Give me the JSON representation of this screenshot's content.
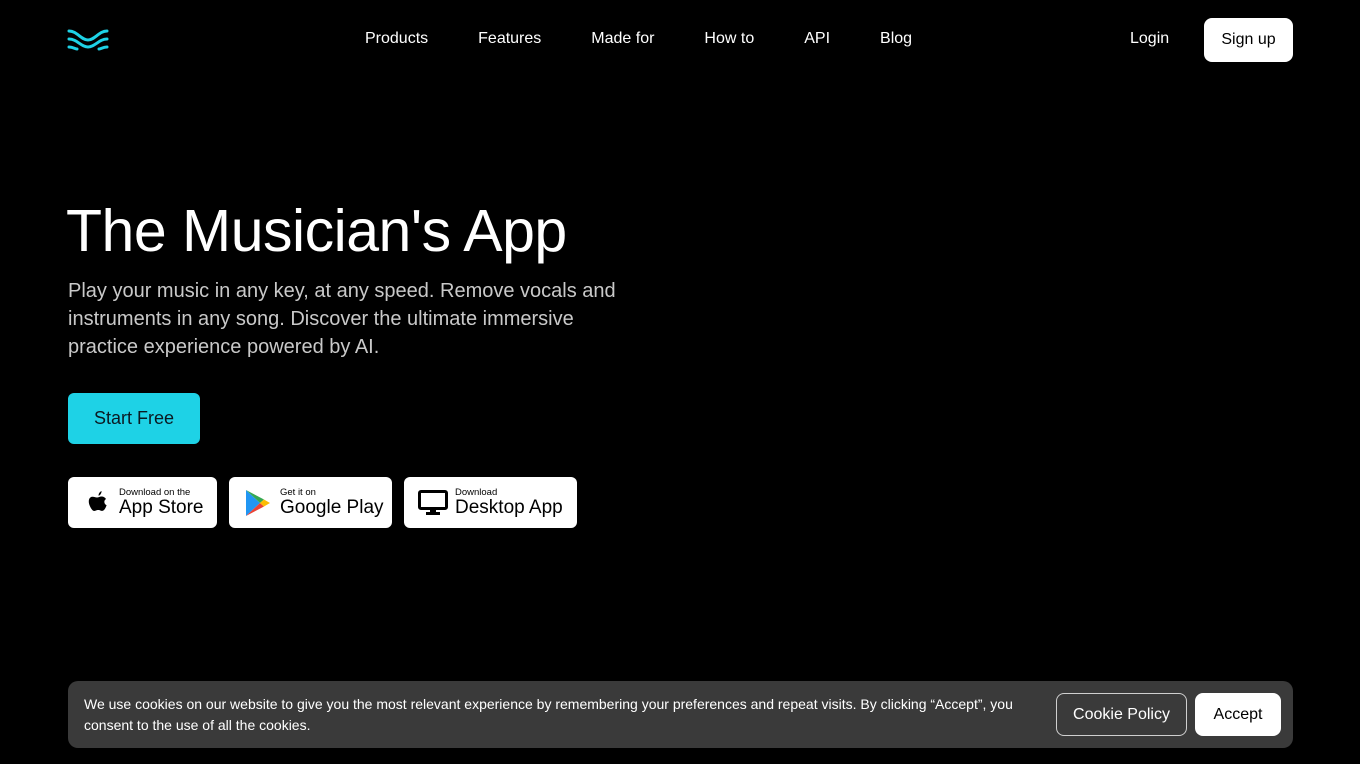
{
  "brand": {
    "logo_icon": "wave-logo-icon",
    "accent_color": "#1ed2e6"
  },
  "nav": {
    "items": [
      {
        "label": "Products"
      },
      {
        "label": "Features"
      },
      {
        "label": "Made for"
      },
      {
        "label": "How to"
      },
      {
        "label": "API"
      },
      {
        "label": "Blog"
      }
    ],
    "login_label": "Login",
    "signup_label": "Sign up"
  },
  "hero": {
    "title": "The Musician's App",
    "subtitle": "Play your music in any key, at any speed. Remove vocals and instruments in any song. Discover the ultimate immersive practice experience powered by AI.",
    "cta_label": "Start Free"
  },
  "downloads": {
    "app_store": {
      "small": "Download on the",
      "big": "App Store",
      "icon": "apple-icon"
    },
    "google_play": {
      "small": "Get it on",
      "big": "Google Play",
      "icon": "google-play-icon"
    },
    "desktop": {
      "small": "Download",
      "big": "Desktop App",
      "icon": "monitor-icon"
    }
  },
  "cookie_banner": {
    "text": "We use cookies on our website to give you the most relevant experience by remembering your preferences and repeat visits. By clicking “Accept”, you consent to the use of all the cookies.",
    "policy_label": "Cookie Policy",
    "accept_label": "Accept"
  }
}
